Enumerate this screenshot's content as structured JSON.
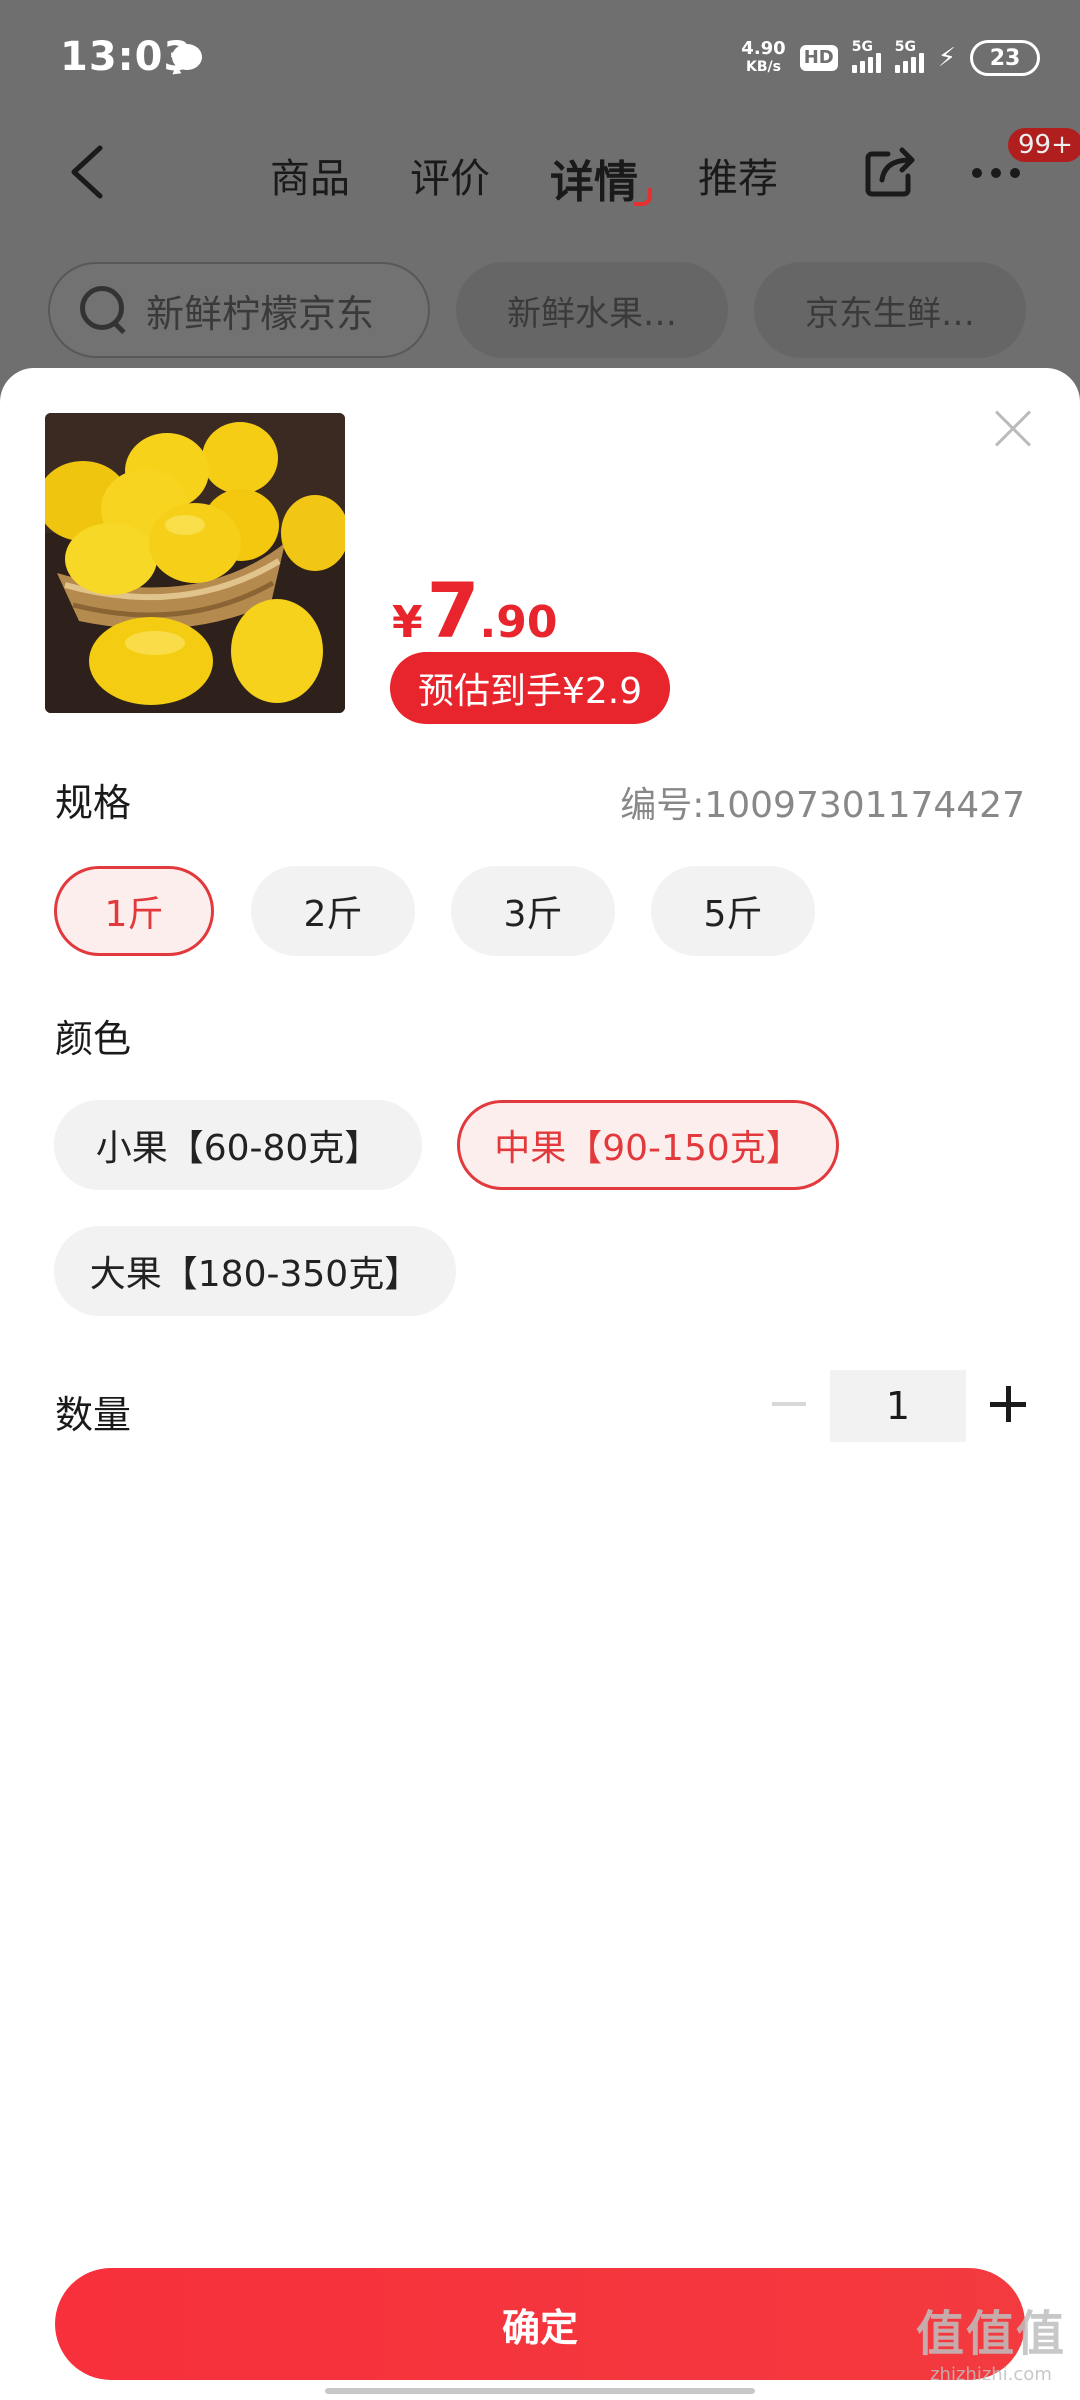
{
  "status_bar": {
    "time": "13:03",
    "net_speed_value": "4.90",
    "net_speed_unit": "KB/s",
    "hd_label": "HD",
    "signal1_label": "5G",
    "signal2_label": "5G",
    "battery_level": "23"
  },
  "nav": {
    "tabs": [
      {
        "label": "商品"
      },
      {
        "label": "评价"
      },
      {
        "label": "详情"
      },
      {
        "label": "推荐"
      }
    ],
    "active_tab": "详情",
    "more_badge": "99+"
  },
  "search_bar": {
    "query": "新鲜柠檬京东",
    "chips": [
      "新鲜水果…",
      "京东生鲜…"
    ]
  },
  "product": {
    "image_icon": "lemon-basket-photo",
    "price_currency": "¥",
    "price_integer": "7",
    "price_decimal": ".90",
    "estimated_label": "预估到手¥2.9"
  },
  "spec": {
    "label": "规格",
    "sku_label": "编号:10097301174427",
    "options": [
      "1斤",
      "2斤",
      "3斤",
      "5斤"
    ],
    "selected": "1斤"
  },
  "color": {
    "label": "颜色",
    "options": [
      "小果【60-80克】",
      "中果【90-150克】",
      "大果【180-350克】"
    ],
    "selected": "中果【90-150克】"
  },
  "quantity": {
    "label": "数量",
    "value": "1"
  },
  "confirm_label": "确定",
  "watermark": {
    "main": "值值值",
    "sub": "zhizhizhi.com"
  },
  "colors": {
    "accent": "#e8252d",
    "selected_border": "#e2393d",
    "selected_bg": "#fdeeee",
    "option_bg": "#f2f2f2",
    "overlay": "#6f6f6f"
  }
}
